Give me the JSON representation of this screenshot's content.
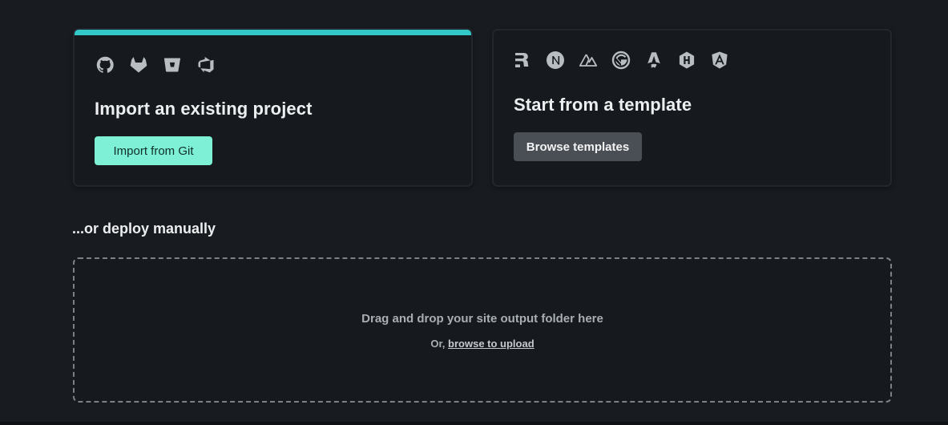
{
  "import_card": {
    "providers": [
      {
        "icon": "github-icon"
      },
      {
        "icon": "gitlab-icon"
      },
      {
        "icon": "bitbucket-icon"
      },
      {
        "icon": "azure-devops-icon"
      }
    ],
    "title": "Import an existing project",
    "button_label": "Import from Git",
    "accent_color": "#32c8c8",
    "button_color": "#7ef0d6"
  },
  "template_card": {
    "frameworks": [
      {
        "icon": "remix-icon"
      },
      {
        "icon": "nextjs-icon"
      },
      {
        "icon": "nuxt-icon"
      },
      {
        "icon": "gatsby-icon"
      },
      {
        "icon": "astro-icon"
      },
      {
        "icon": "hugo-icon"
      },
      {
        "icon": "angular-icon"
      }
    ],
    "title": "Start from a template",
    "button_label": "Browse templates"
  },
  "manual_deploy": {
    "heading": "...or deploy manually",
    "drop_text": "Drag and drop your site output folder here",
    "or_text": "Or, ",
    "browse_link": "browse to upload"
  }
}
